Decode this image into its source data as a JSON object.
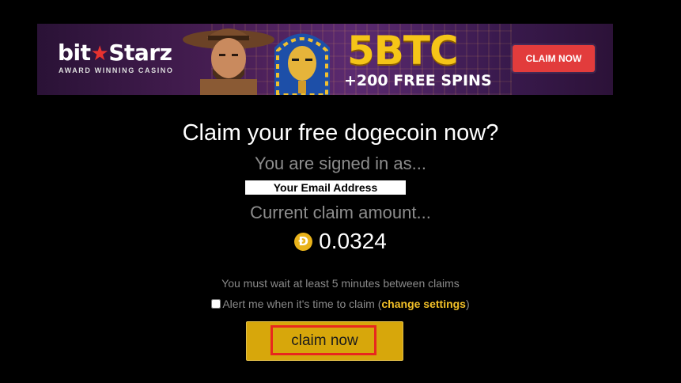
{
  "banner": {
    "brand_prefix": "bit",
    "brand_star": "★",
    "brand_suffix": "Starz",
    "tagline": "AWARD WINNING CASINO",
    "promo_main": "5BTC",
    "promo_sub": "+200 FREE SPINS",
    "cta_label": "CLAIM NOW",
    "colors": {
      "accent": "#f5c518",
      "cta": "#e23c3c",
      "background": "#4a1f56"
    }
  },
  "main": {
    "title": "Claim your free dogecoin now?",
    "signed_in_label": "You are signed in as...",
    "email_value": "Your Email Address",
    "amount_label": "Current claim amount...",
    "coin_icon": "dogecoin-icon",
    "coin_glyph": "Ð",
    "amount_value": "0.0324",
    "wait_notice": "You must wait at least 5 minutes between claims",
    "alert_label": "Alert me when it's time to claim (",
    "alert_link": "change settings",
    "alert_close": ")",
    "alert_checked": false,
    "claim_button_label": "claim now",
    "colors": {
      "claim_button": "#d7a70b",
      "highlight": "#e8271e",
      "link": "#f2c028"
    }
  }
}
